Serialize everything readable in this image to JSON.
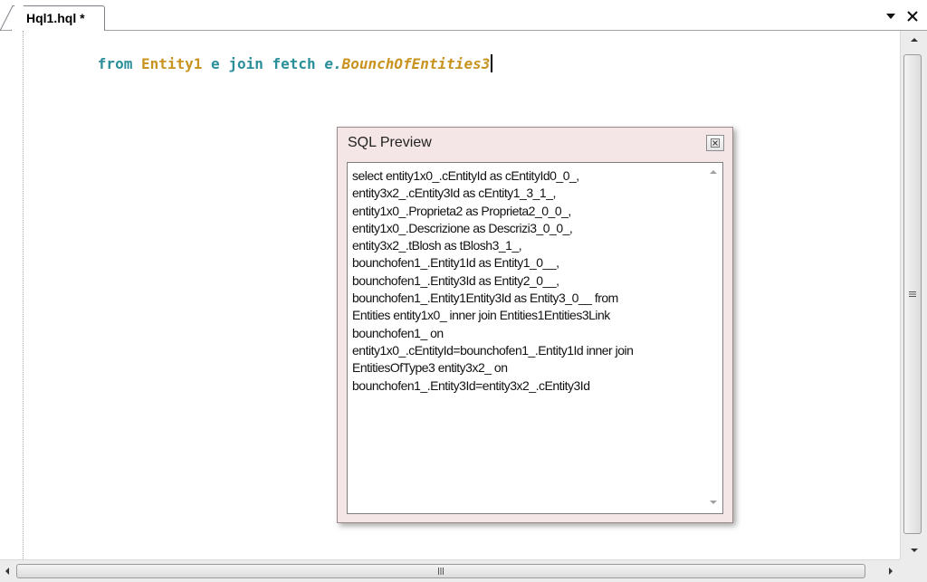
{
  "tab": {
    "label": "Hql1.hql *"
  },
  "editor": {
    "tokens": [
      {
        "text": "from",
        "kind": "kw"
      },
      {
        "text": " ",
        "kind": "space"
      },
      {
        "text": "Entity1",
        "kind": "id"
      },
      {
        "text": " ",
        "kind": "space"
      },
      {
        "text": "e",
        "kind": "kw"
      },
      {
        "text": " ",
        "kind": "space"
      },
      {
        "text": "join",
        "kind": "kw"
      },
      {
        "text": " ",
        "kind": "space"
      },
      {
        "text": "fetch",
        "kind": "kw"
      },
      {
        "text": " ",
        "kind": "space"
      },
      {
        "text": "e.",
        "kind": "kw-italic"
      },
      {
        "text": "BounchOfEntities3",
        "kind": "path"
      }
    ]
  },
  "sql_preview": {
    "title": "SQL Preview",
    "lines": [
      "select entity1x0_.cEntityId as cEntityId0_0_,",
      "entity3x2_.cEntity3Id as cEntity1_3_1_,",
      "entity1x0_.Proprieta2 as Proprieta2_0_0_,",
      "entity1x0_.Descrizione as Descrizi3_0_0_,",
      "entity3x2_.tBlosh as tBlosh3_1_,",
      "bounchofen1_.Entity1Id as Entity1_0__,",
      "bounchofen1_.Entity3Id as Entity2_0__,",
      "bounchofen1_.Entity1Entity3Id as Entity3_0__ from",
      "Entities entity1x0_ inner join Entities1Entities3Link",
      "bounchofen1_ on",
      "entity1x0_.cEntityId=bounchofen1_.Entity1Id inner join",
      "EntitiesOfType3 entity3x2_ on",
      "bounchofen1_.Entity3Id=entity3x2_.cEntity3Id"
    ]
  },
  "colors": {
    "keyword": "#2a8f9a",
    "identifier": "#c8931f",
    "popup_background": "#f4e6e6"
  },
  "icons": [
    "dropdown-arrow-icon",
    "close-icon",
    "scroll-up-icon",
    "scroll-down-icon",
    "scroll-left-icon",
    "scroll-right-icon",
    "grip-icon"
  ]
}
